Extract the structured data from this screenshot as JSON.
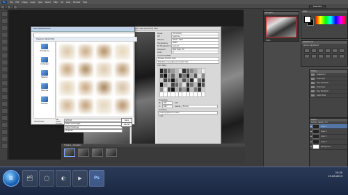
{
  "menubar": {
    "logo": "Ps",
    "items": [
      "File",
      "Edit",
      "Image",
      "Layer",
      "Type",
      "Select",
      "Filter",
      "3D",
      "View",
      "Window",
      "Help"
    ]
  },
  "optionsbar": {
    "workspace": "Essentials"
  },
  "navigator": {
    "title": "Navigator",
    "zoom": "100%"
  },
  "color_panel": {
    "title": "Color"
  },
  "adjustments": {
    "title": "Adjustments",
    "subtitle": "Add an adjustment"
  },
  "history": {
    "title": "History",
    "items": [
      "snapshot 1",
      "Snap layer",
      "Free Transform",
      "Snap layer",
      "Free Transform",
      "Layer Style"
    ]
  },
  "layers": {
    "title": "Layers",
    "controls": "Normal · Opacity · Fill",
    "rows": [
      "Layer 3",
      "Layer 2",
      "Layer 1",
      "Layer 0",
      "Background"
    ]
  },
  "sfw": {
    "title": "Save for Web (Photoshop CS6)",
    "preset_label": "Preset:",
    "preset_value": "[Unnamed]",
    "rows": [
      {
        "label": "GIF",
        "value": "Selective"
      },
      {
        "label": "Diffusion",
        "value": "Dither: 100%"
      },
      {
        "label": "Transparency",
        "value": "Matte:"
      },
      {
        "label": "No Transparency",
        "value": "Amount:"
      },
      {
        "label": "Interlaced",
        "value": "Web Snap: 0%"
      },
      {
        "label": "Lossy",
        "value": "0"
      }
    ],
    "convert": "Convert to sRGB",
    "preview_label": "Preview: Monitor Color",
    "metadata": "Metadata: Copyright and Contact Info",
    "colortable": "Color Table",
    "imagesize": "Image Size",
    "w_label": "W:",
    "w_val": "480",
    "h_label": "H:",
    "h_val": "640",
    "percent": "100",
    "quality_label": "Quality:",
    "quality_val": "Bicubic",
    "animation": "Animation",
    "looping": "Looping Options: Forever",
    "frames": "1 of 1",
    "done": "Done",
    "cancel": "Cancel",
    "save": "Save..."
  },
  "saveas": {
    "title": "Save Optimized As",
    "tools": "Organize ▾   New folder",
    "nav": [
      "Homegroup",
      "Computer",
      "Network",
      "Libraries",
      "Desktop"
    ],
    "name_label": "File name:",
    "name_value": "gifimg2",
    "format_label": "Format:",
    "format_value": "HTML and Images",
    "settings_label": "Settings:",
    "settings_value": "Default Settings",
    "slices_label": "Slices:",
    "slices_value": "All Slices",
    "save": "Save",
    "cancel": "Cancel",
    "hide": "Hide Folders",
    "file_colors": [
      "#d9c6a6",
      "#c9a882",
      "#b38a5c",
      "#e7d7b8",
      "#c4a07a",
      "#a98559",
      "#dbc9ac",
      "#b8936a",
      "#e0cfb0",
      "#c7a27b",
      "#a37d55",
      "#d4bea0",
      "#cfb38f",
      "#bf9b72",
      "#e4d5bb",
      "#b48e66"
    ]
  },
  "filmstrip": {
    "tab": "Timeline · Animation"
  },
  "taskbar": {
    "start": "⊞",
    "apps": [
      "🗂",
      "◯",
      "◐",
      "▶",
      "Ps"
    ],
    "time": "23:35",
    "date": "25.08.2013"
  }
}
